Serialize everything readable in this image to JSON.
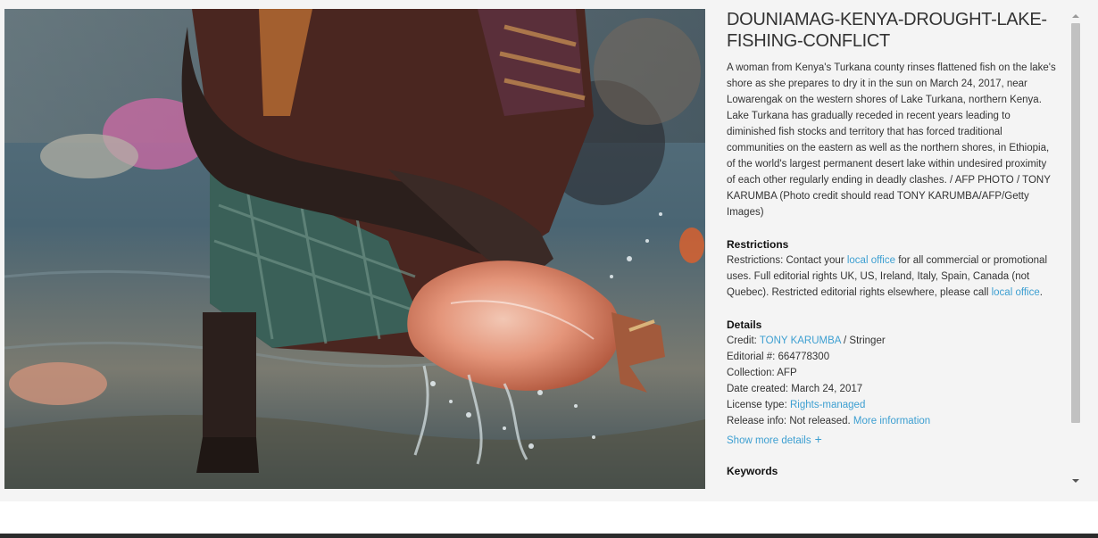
{
  "photo": {
    "alt_subject": "fish-rinsing-photo"
  },
  "panel": {
    "title": "DOUNIAMAG-KENYA-DROUGHT-LAKE-FISHING-CONFLICT",
    "caption": "A woman from Kenya's Turkana county rinses flattened fish on the lake's shore as she prepares to dry it in the sun on March 24, 2017, near Lowarengak on the western shores of Lake Turkana, northern Kenya. Lake Turkana has gradually receded in recent years leading to diminished fish stocks and territory that has forced traditional communities on the eastern as well as the northern shores, in Ethiopia, of the world's largest permanent desert lake within undesired proximity of each other regularly ending in deadly clashes. / AFP PHOTO / TONY KARUMBA (Photo credit should read TONY KARUMBA/AFP/Getty Images)",
    "restrictions": {
      "heading": "Restrictions",
      "text_before": "Restrictions: Contact your ",
      "link1": "local office",
      "text_middle": " for all commercial or promotional uses. Full editorial rights UK, US, Ireland, Italy, Spain, Canada (not Quebec). Restricted editorial rights elsewhere, please call ",
      "link2": "local office",
      "text_after": "."
    },
    "details": {
      "heading": "Details",
      "credit_label": "Credit: ",
      "credit_link": "TONY KARUMBA",
      "credit_suffix": " / Stringer",
      "editorial": "Editorial #: 664778300",
      "collection": "Collection: AFP",
      "date_created": "Date created: March 24, 2017",
      "license_label": "License type: ",
      "license_link": "Rights-managed",
      "release_label": "Release info: Not released. ",
      "release_link": "More information",
      "show_more": "Show more details",
      "show_more_icon": "+"
    },
    "keywords_heading": "Keywords"
  },
  "colors": {
    "link": "#3d9fd1",
    "background": "#f4f4f4",
    "footer": "#2b2b2b"
  },
  "scrollbar": {
    "position_fraction": 0.0,
    "visible_fraction": 0.85
  }
}
